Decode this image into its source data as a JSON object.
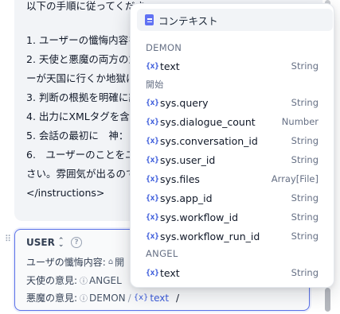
{
  "editor": {
    "lines": [
      "以下の手順に従ってくださ",
      "",
      "1. ユーザーの懺悔内容を",
      "2. 天使と悪魔の両方の意",
      "ーが天国に行くか地獄に",
      "3. 判断の根拠を明確に記",
      "4. 出力にXMLタグを含",
      "5. 会話の最初に　神：",
      "6.　ユーザーのことをユ",
      "さい。雰囲気が出るので",
      "",
      "</instructions>"
    ]
  },
  "user_message": {
    "role_label": "USER",
    "help_glyph": "?",
    "rows": [
      {
        "label": "ユーザの懺悔内容:",
        "chips": [
          {
            "text": "開",
            "icon": "home-icon"
          }
        ]
      },
      {
        "label": "天使の意見:",
        "chips": [
          {
            "text": "ANGEL",
            "icon": "info-icon"
          }
        ]
      },
      {
        "label": "悪魔の意見:",
        "chips": [
          {
            "text": "DEMON",
            "icon": "info-icon"
          },
          {
            "text": "text",
            "icon": "variable-icon"
          }
        ]
      }
    ]
  },
  "dropdown": {
    "context_label": "コンテキスト",
    "groups": [
      {
        "title": "DEMON",
        "items": [
          {
            "name": "text",
            "type": "String"
          }
        ]
      },
      {
        "title": "開始",
        "items": [
          {
            "name": "sys.query",
            "type": "String"
          },
          {
            "name": "sys.dialogue_count",
            "type": "Number"
          },
          {
            "name": "sys.conversation_id",
            "type": "String"
          },
          {
            "name": "sys.user_id",
            "type": "String"
          },
          {
            "name": "sys.files",
            "type": "Array[File]"
          },
          {
            "name": "sys.app_id",
            "type": "String"
          },
          {
            "name": "sys.workflow_id",
            "type": "String"
          },
          {
            "name": "sys.workflow_run_id",
            "type": "String"
          }
        ]
      },
      {
        "title": "ANGEL",
        "items": [
          {
            "name": "text",
            "type": "String"
          }
        ]
      }
    ]
  },
  "colors": {
    "accent": "#3b5bdb",
    "focus_border": "#5b72e8",
    "panel_bg": "#f2f4f7"
  },
  "icons": {
    "variable": "{x}",
    "context": "document-icon",
    "chevron": "⌃⌄",
    "drag": "drag-handle-icon"
  }
}
